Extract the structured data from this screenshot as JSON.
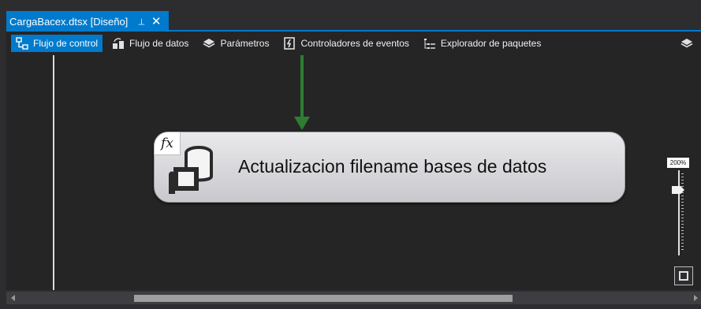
{
  "document_tab": {
    "title": "CargaBacex.dtsx [Diseño]",
    "pin_glyph": "⊣",
    "close_glyph": "✕"
  },
  "toolbar": {
    "items": [
      {
        "label": "Flujo de control",
        "icon": "control-flow-icon",
        "active": true
      },
      {
        "label": "Flujo de datos",
        "icon": "data-flow-icon",
        "active": false
      },
      {
        "label": "Parámetros",
        "icon": "parameters-icon",
        "active": false
      },
      {
        "label": "Controladores de eventos",
        "icon": "event-handlers-icon",
        "active": false
      },
      {
        "label": "Explorador de paquetes",
        "icon": "package-explorer-icon",
        "active": false
      }
    ],
    "right_icon": "toolbox-icon"
  },
  "canvas": {
    "task": {
      "label": "Actualizacion filename bases de datos",
      "badge": "fx",
      "icon": "execute-sql-task-icon"
    },
    "precedence_color": "#2e7d32"
  },
  "zoom": {
    "label": "200%"
  },
  "colors": {
    "accent": "#007acc",
    "background": "#252526"
  }
}
